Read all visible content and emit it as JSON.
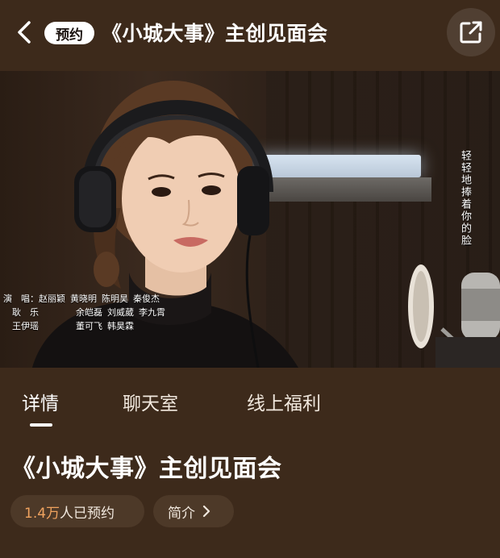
{
  "header": {
    "badge": "预约",
    "title": "《小城大事》主创见面会"
  },
  "video": {
    "credits": [
      {
        "label": "演　唱：",
        "names": [
          "赵丽颖",
          "黄晓明",
          "陈明昊",
          "秦俊杰"
        ]
      },
      {
        "label": "　耿　乐",
        "names": [
          "余皑磊",
          "刘威葳",
          "李九霄"
        ]
      },
      {
        "label": "　王伊瑶",
        "names": [
          "董可飞",
          "韩昊霖"
        ]
      }
    ],
    "lyric": "轻轻地捧着你的脸"
  },
  "tabs": [
    {
      "label": "详情",
      "active": true
    },
    {
      "label": "聊天室",
      "active": false
    },
    {
      "label": "线上福利",
      "active": false
    }
  ],
  "event": {
    "title": "《小城大事》主创见面会"
  },
  "reserve": {
    "count": "1.4万",
    "suffix": "人已预约"
  },
  "intro": {
    "label": "简介"
  },
  "colors": {
    "background": "#3d2a1b",
    "accent": "#f0a35f",
    "pill": "#4d3928"
  },
  "icons": {
    "back": "chevron-left-icon",
    "share": "share-icon",
    "intro": "chevron-right-icon"
  }
}
